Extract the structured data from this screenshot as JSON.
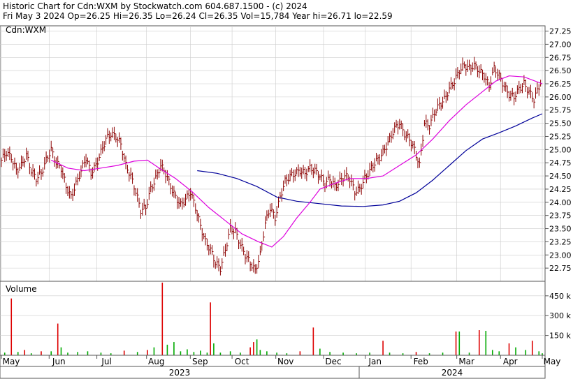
{
  "header": {
    "title_line": "Historic Chart for Cdn:WXM by Stockwatch.com 604.687.1500 - (c) 2024",
    "quote_line": "Fri May  3 2024   Op=26.25   Hi=26.35   Lo=26.24   Cl=26.35   Vol=15,784   Year hi=26.71   lo=22.59"
  },
  "price_panel": {
    "symbol_label": "Cdn:WXM"
  },
  "volume_panel": {
    "label": "Volume"
  },
  "colors": {
    "up": "#00aa00",
    "down": "#dd0000",
    "bar": "#8b0000",
    "ma_short": "#dd00dd",
    "ma_long": "#000099",
    "grid": "#cccccc"
  },
  "chart_data": {
    "type": "ohlc",
    "subtype": "stock price bars with moving averages and volume",
    "ylim": [
      22.5,
      27.35
    ],
    "y_ticks": [
      "27.25",
      "27.00",
      "26.75",
      "26.50",
      "26.25",
      "26.00",
      "25.75",
      "25.50",
      "25.25",
      "25.00",
      "24.75",
      "24.50",
      "24.25",
      "24.00",
      "23.75",
      "23.50",
      "23.25",
      "23.00",
      "22.75"
    ],
    "months": [
      "May",
      "Jun",
      "Jul",
      "Aug",
      "Sep",
      "Oct",
      "Nov",
      "Dec",
      "Jan",
      "Feb",
      "Mar",
      "Apr",
      "May"
    ],
    "years": [
      "2023",
      "2024"
    ],
    "grid": true,
    "volume": {
      "ylim": [
        0,
        560
      ],
      "unit": "k",
      "ticks": [
        "450 k",
        "300 k",
        "150 k"
      ]
    },
    "price_series": [
      {
        "i": 0,
        "date": "2023-05-01",
        "price": 24.8
      },
      {
        "i": 3,
        "price": 24.95
      },
      {
        "i": 6,
        "price": 24.85
      },
      {
        "i": 9,
        "price": 24.6
      },
      {
        "i": 12,
        "price": 24.7
      },
      {
        "i": 15,
        "price": 24.9
      },
      {
        "i": 18,
        "price": 24.6
      },
      {
        "i": 21,
        "price": 24.45
      },
      {
        "i": 24,
        "price": 24.55
      },
      {
        "i": 27,
        "price": 24.8
      },
      {
        "i": 30,
        "price": 25.0
      },
      {
        "i": 33,
        "price": 24.75
      },
      {
        "i": 36,
        "price": 24.65
      },
      {
        "i": 39,
        "price": 24.3
      },
      {
        "i": 42,
        "price": 24.1
      },
      {
        "i": 45,
        "price": 24.35
      },
      {
        "i": 48,
        "price": 24.6
      },
      {
        "i": 51,
        "price": 24.85
      },
      {
        "i": 54,
        "price": 24.55
      },
      {
        "i": 57,
        "price": 24.7
      },
      {
        "i": 60,
        "price": 24.95
      },
      {
        "i": 63,
        "price": 25.2
      },
      {
        "i": 66,
        "price": 25.3
      },
      {
        "i": 69,
        "price": 25.25
      },
      {
        "i": 72,
        "price": 25.1
      },
      {
        "i": 75,
        "price": 24.7
      },
      {
        "i": 78,
        "price": 24.5
      },
      {
        "i": 81,
        "price": 24.2
      },
      {
        "i": 84,
        "price": 23.85
      },
      {
        "i": 87,
        "price": 23.9
      },
      {
        "i": 90,
        "price": 24.25
      },
      {
        "i": 93,
        "price": 24.45
      },
      {
        "i": 96,
        "price": 24.7
      },
      {
        "i": 99,
        "price": 24.55
      },
      {
        "i": 102,
        "price": 24.3
      },
      {
        "i": 105,
        "price": 24.1
      },
      {
        "i": 108,
        "price": 23.95
      },
      {
        "i": 111,
        "price": 24.05
      },
      {
        "i": 114,
        "price": 24.2
      },
      {
        "i": 117,
        "price": 23.9
      },
      {
        "i": 120,
        "price": 23.55
      },
      {
        "i": 123,
        "price": 23.25
      },
      {
        "i": 126,
        "price": 23.1
      },
      {
        "i": 129,
        "price": 22.85
      },
      {
        "i": 132,
        "price": 22.75
      },
      {
        "i": 135,
        "price": 23.1
      },
      {
        "i": 138,
        "price": 23.5
      },
      {
        "i": 141,
        "price": 23.45
      },
      {
        "i": 144,
        "price": 23.2
      },
      {
        "i": 147,
        "price": 23.0
      },
      {
        "i": 150,
        "price": 22.85
      },
      {
        "i": 153,
        "price": 22.7
      },
      {
        "i": 156,
        "price": 23.0
      },
      {
        "i": 159,
        "price": 23.6
      },
      {
        "i": 162,
        "price": 23.9
      },
      {
        "i": 165,
        "price": 23.7
      },
      {
        "i": 168,
        "price": 24.1
      },
      {
        "i": 171,
        "price": 24.4
      },
      {
        "i": 174,
        "price": 24.5
      },
      {
        "i": 177,
        "price": 24.55
      },
      {
        "i": 180,
        "price": 24.6
      },
      {
        "i": 183,
        "price": 24.55
      },
      {
        "i": 186,
        "price": 24.65
      },
      {
        "i": 189,
        "price": 24.6
      },
      {
        "i": 192,
        "price": 24.5
      },
      {
        "i": 195,
        "price": 24.35
      },
      {
        "i": 198,
        "price": 24.45
      },
      {
        "i": 201,
        "price": 24.3
      },
      {
        "i": 204,
        "price": 24.4
      },
      {
        "i": 207,
        "price": 24.5
      },
      {
        "i": 210,
        "price": 24.45
      },
      {
        "i": 213,
        "price": 24.2
      },
      {
        "i": 216,
        "price": 24.25
      },
      {
        "i": 219,
        "price": 24.45
      },
      {
        "i": 222,
        "price": 24.6
      },
      {
        "i": 225,
        "price": 24.75
      },
      {
        "i": 228,
        "price": 24.85
      },
      {
        "i": 231,
        "price": 25.0
      },
      {
        "i": 234,
        "price": 25.2
      },
      {
        "i": 237,
        "price": 25.4
      },
      {
        "i": 240,
        "price": 25.5
      },
      {
        "i": 243,
        "price": 25.3
      },
      {
        "i": 246,
        "price": 25.2
      },
      {
        "i": 249,
        "price": 25.0
      },
      {
        "i": 252,
        "price": 24.7
      },
      {
        "i": 255,
        "price": 25.5
      },
      {
        "i": 258,
        "price": 25.45
      },
      {
        "i": 261,
        "price": 25.7
      },
      {
        "i": 264,
        "price": 25.85
      },
      {
        "i": 267,
        "price": 25.95
      },
      {
        "i": 270,
        "price": 26.15
      },
      {
        "i": 273,
        "price": 26.3
      },
      {
        "i": 276,
        "price": 26.5
      },
      {
        "i": 279,
        "price": 26.6
      },
      {
        "i": 282,
        "price": 26.55
      },
      {
        "i": 285,
        "price": 26.6
      },
      {
        "i": 288,
        "price": 26.5
      },
      {
        "i": 291,
        "price": 26.4
      },
      {
        "i": 294,
        "price": 26.2
      },
      {
        "i": 297,
        "price": 26.55
      },
      {
        "i": 300,
        "price": 26.4
      },
      {
        "i": 303,
        "price": 26.2
      },
      {
        "i": 306,
        "price": 26.05
      },
      {
        "i": 309,
        "price": 26.0
      },
      {
        "i": 312,
        "price": 26.15
      },
      {
        "i": 315,
        "price": 26.25
      },
      {
        "i": 318,
        "price": 26.1
      },
      {
        "i": 321,
        "price": 25.95
      },
      {
        "i": 324,
        "price": 26.2
      },
      {
        "i": 326,
        "date": "2024-05-03",
        "price": 26.35
      }
    ],
    "ma_short": [
      {
        "i": 30,
        "price": 24.8
      },
      {
        "i": 40,
        "price": 24.65
      },
      {
        "i": 50,
        "price": 24.6
      },
      {
        "i": 60,
        "price": 24.65
      },
      {
        "i": 70,
        "price": 24.7
      },
      {
        "i": 80,
        "price": 24.78
      },
      {
        "i": 88,
        "price": 24.8
      },
      {
        "i": 95,
        "price": 24.65
      },
      {
        "i": 105,
        "price": 24.45
      },
      {
        "i": 115,
        "price": 24.2
      },
      {
        "i": 125,
        "price": 23.9
      },
      {
        "i": 135,
        "price": 23.65
      },
      {
        "i": 145,
        "price": 23.4
      },
      {
        "i": 155,
        "price": 23.25
      },
      {
        "i": 163,
        "price": 23.15
      },
      {
        "i": 170,
        "price": 23.35
      },
      {
        "i": 178,
        "price": 23.7
      },
      {
        "i": 186,
        "price": 24.0
      },
      {
        "i": 192,
        "price": 24.25
      },
      {
        "i": 200,
        "price": 24.35
      },
      {
        "i": 210,
        "price": 24.45
      },
      {
        "i": 220,
        "price": 24.45
      },
      {
        "i": 230,
        "price": 24.5
      },
      {
        "i": 240,
        "price": 24.7
      },
      {
        "i": 250,
        "price": 24.9
      },
      {
        "i": 260,
        "price": 25.2
      },
      {
        "i": 270,
        "price": 25.55
      },
      {
        "i": 280,
        "price": 25.85
      },
      {
        "i": 290,
        "price": 26.1
      },
      {
        "i": 298,
        "price": 26.3
      },
      {
        "i": 306,
        "price": 26.4
      },
      {
        "i": 315,
        "price": 26.38
      },
      {
        "i": 326,
        "price": 26.25
      }
    ],
    "ma_long": [
      {
        "i": 118,
        "price": 24.6
      },
      {
        "i": 130,
        "price": 24.55
      },
      {
        "i": 142,
        "price": 24.45
      },
      {
        "i": 154,
        "price": 24.3
      },
      {
        "i": 166,
        "price": 24.1
      },
      {
        "i": 178,
        "price": 24.02
      },
      {
        "i": 190,
        "price": 23.98
      },
      {
        "i": 205,
        "price": 23.93
      },
      {
        "i": 218,
        "price": 23.92
      },
      {
        "i": 230,
        "price": 23.95
      },
      {
        "i": 240,
        "price": 24.02
      },
      {
        "i": 250,
        "price": 24.18
      },
      {
        "i": 260,
        "price": 24.42
      },
      {
        "i": 270,
        "price": 24.7
      },
      {
        "i": 280,
        "price": 24.98
      },
      {
        "i": 290,
        "price": 25.2
      },
      {
        "i": 300,
        "price": 25.32
      },
      {
        "i": 310,
        "price": 25.45
      },
      {
        "i": 320,
        "price": 25.6
      },
      {
        "i": 326,
        "price": 25.68
      }
    ],
    "volume_bars": [
      {
        "i": 2,
        "vol": 20
      },
      {
        "i": 6,
        "vol": 430
      },
      {
        "i": 10,
        "vol": 25
      },
      {
        "i": 14,
        "vol": 40
      },
      {
        "i": 18,
        "vol": 15
      },
      {
        "i": 24,
        "vol": 30
      },
      {
        "i": 30,
        "vol": 30
      },
      {
        "i": 34,
        "vol": 240
      },
      {
        "i": 36,
        "vol": 60
      },
      {
        "i": 40,
        "vol": 20
      },
      {
        "i": 46,
        "vol": 25
      },
      {
        "i": 52,
        "vol": 30
      },
      {
        "i": 60,
        "vol": 20
      },
      {
        "i": 66,
        "vol": 15
      },
      {
        "i": 74,
        "vol": 35
      },
      {
        "i": 82,
        "vol": 25
      },
      {
        "i": 88,
        "vol": 40
      },
      {
        "i": 92,
        "vol": 60
      },
      {
        "i": 97,
        "vol": 550
      },
      {
        "i": 100,
        "vol": 80
      },
      {
        "i": 104,
        "vol": 100
      },
      {
        "i": 108,
        "vol": 30
      },
      {
        "i": 112,
        "vol": 45
      },
      {
        "i": 116,
        "vol": 25
      },
      {
        "i": 120,
        "vol": 35
      },
      {
        "i": 124,
        "vol": 20
      },
      {
        "i": 126,
        "vol": 400
      },
      {
        "i": 128,
        "vol": 90
      },
      {
        "i": 132,
        "vol": 20
      },
      {
        "i": 138,
        "vol": 30
      },
      {
        "i": 144,
        "vol": 20
      },
      {
        "i": 150,
        "vol": 60
      },
      {
        "i": 152,
        "vol": 100
      },
      {
        "i": 154,
        "vol": 120
      },
      {
        "i": 156,
        "vol": 40
      },
      {
        "i": 160,
        "vol": 30
      },
      {
        "i": 166,
        "vol": 20
      },
      {
        "i": 172,
        "vol": 15
      },
      {
        "i": 180,
        "vol": 30
      },
      {
        "i": 188,
        "vol": 210
      },
      {
        "i": 192,
        "vol": 50
      },
      {
        "i": 198,
        "vol": 25
      },
      {
        "i": 206,
        "vol": 20
      },
      {
        "i": 214,
        "vol": 15
      },
      {
        "i": 222,
        "vol": 20
      },
      {
        "i": 230,
        "vol": 110
      },
      {
        "i": 234,
        "vol": 20
      },
      {
        "i": 242,
        "vol": 15
      },
      {
        "i": 250,
        "vol": 25
      },
      {
        "i": 258,
        "vol": 15
      },
      {
        "i": 266,
        "vol": 20
      },
      {
        "i": 274,
        "vol": 180
      },
      {
        "i": 276,
        "vol": 180
      },
      {
        "i": 282,
        "vol": 20
      },
      {
        "i": 288,
        "vol": 190
      },
      {
        "i": 292,
        "vol": 185
      },
      {
        "i": 296,
        "vol": 40
      },
      {
        "i": 300,
        "vol": 30
      },
      {
        "i": 306,
        "vol": 90
      },
      {
        "i": 310,
        "vol": 60
      },
      {
        "i": 316,
        "vol": 40
      },
      {
        "i": 320,
        "vol": 110
      },
      {
        "i": 324,
        "vol": 30
      },
      {
        "i": 326,
        "vol": 15
      }
    ]
  }
}
